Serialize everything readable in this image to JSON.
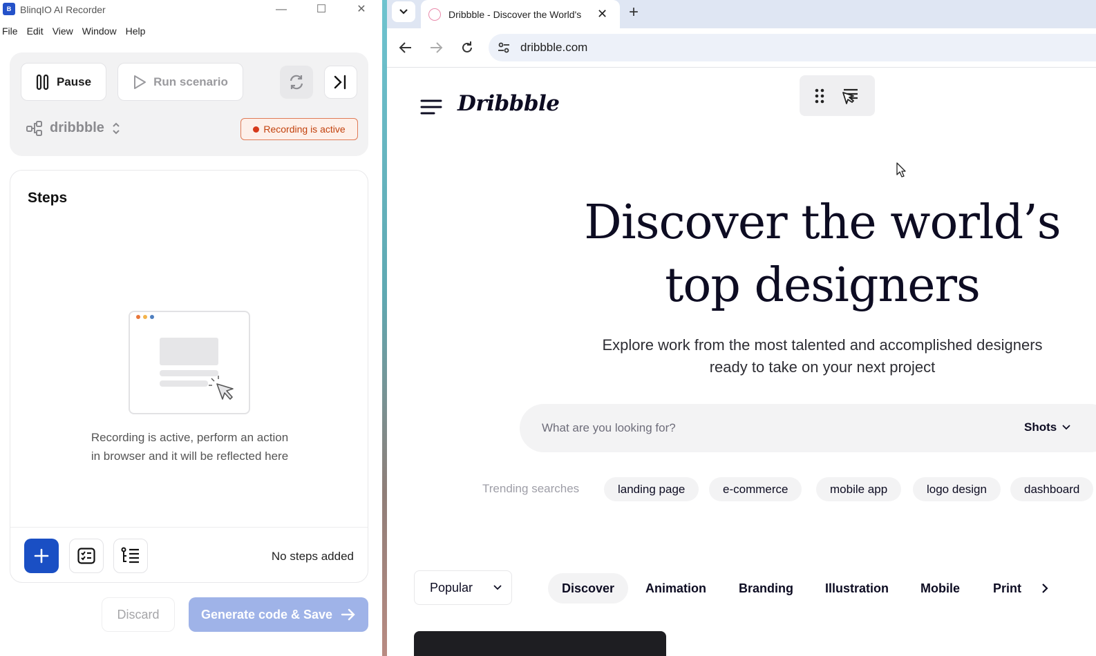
{
  "recorder": {
    "window_title": "BlinqIO AI Recorder",
    "window_controls": {
      "minimize": "—",
      "maximize": "☐",
      "close": "✕"
    },
    "menu": [
      "File",
      "Edit",
      "View",
      "Window",
      "Help"
    ],
    "pause_label": "Pause",
    "run_label": "Run scenario",
    "project_name": "dribbble",
    "recording_badge": "Recording is active",
    "steps_title": "Steps",
    "empty_line1": "Recording is active, perform an action",
    "empty_line2": "in browser and it will be reflected here",
    "no_steps": "No steps added",
    "discard_label": "Discard",
    "generate_label": "Generate code & Save"
  },
  "browser": {
    "tab_title": "Dribbble - Discover the World's",
    "url": "dribbble.com",
    "new_tab": "+",
    "tab_close": "✕"
  },
  "dribbble": {
    "logo": "Dribbble",
    "hero_line1": "Discover the world’s",
    "hero_line2": "top designers",
    "sub_line1": "Explore work from the most talented and accomplished designers",
    "sub_line2": "ready to take on your next project",
    "search_placeholder": "What are you looking for?",
    "search_scope": "Shots",
    "trending_label": "Trending searches",
    "trending": [
      "landing page",
      "e-commerce",
      "mobile app",
      "logo design",
      "dashboard"
    ],
    "filter": "Popular",
    "categories": [
      "Discover",
      "Animation",
      "Branding",
      "Illustration",
      "Mobile",
      "Print"
    ]
  },
  "colors": {
    "accent_blue": "#1a4fc4",
    "recording_red": "#d6391a",
    "dribbble_ink": "#0d0c22"
  }
}
